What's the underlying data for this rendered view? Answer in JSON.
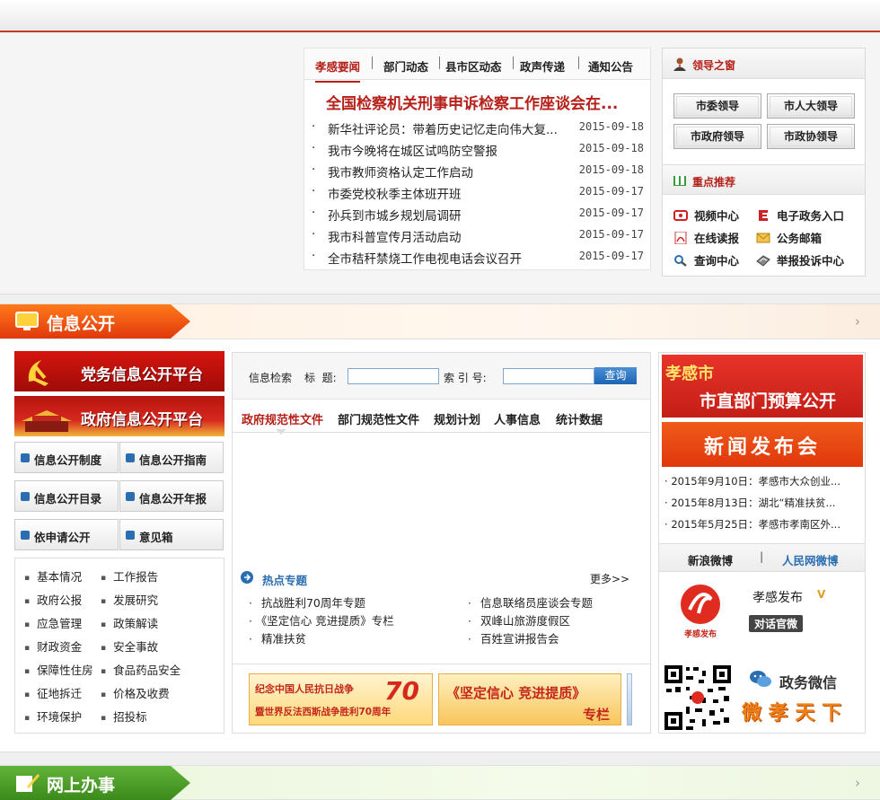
{
  "news": {
    "tabs": [
      "孝感要闻",
      "部门动态",
      "县市区动态",
      "政声传递",
      "通知公告"
    ],
    "headline": "全国检察机关刑事申诉检察工作座谈会在...",
    "items": [
      {
        "title": "新华社评论员：带着历史记忆走向伟大复...",
        "date": "2015-09-18"
      },
      {
        "title": "我市今晚将在城区试鸣防空警报",
        "date": "2015-09-18"
      },
      {
        "title": "我市教师资格认定工作启动",
        "date": "2015-09-18"
      },
      {
        "title": "市委党校秋季主体班开班",
        "date": "2015-09-17"
      },
      {
        "title": "孙兵到市城乡规划局调研",
        "date": "2015-09-17"
      },
      {
        "title": "我市科普宣传月活动启动",
        "date": "2015-09-17"
      },
      {
        "title": "全市秸秆禁烧工作电视电话会议召开",
        "date": "2015-09-17"
      }
    ]
  },
  "leader": {
    "title": "领导之窗",
    "buttons": [
      "市委领导",
      "市人大领导",
      "市政府领导",
      "市政协领导"
    ]
  },
  "featured": {
    "title": "重点推荐",
    "links": [
      "视频中心",
      "电子政务入口",
      "在线读报",
      "公务邮箱",
      "查询中心",
      "举报投诉中心"
    ]
  },
  "info_section": {
    "title": "信息公开",
    "banners": [
      "党务信息公开平台",
      "政府信息公开平台"
    ],
    "buttons": [
      "信息公开制度",
      "信息公开指南",
      "信息公开目录",
      "信息公开年报",
      "依申请公开",
      "意见箱"
    ],
    "categories": [
      "基本情况",
      "工作报告",
      "政府公报",
      "发展研究",
      "应急管理",
      "政策解读",
      "财政资金",
      "安全事故",
      "保障性住房",
      "食品药品安全",
      "征地拆迁",
      "价格及收费",
      "环境保护",
      "招投标"
    ]
  },
  "search": {
    "label": "信息检索",
    "title_label": "标  题:",
    "index_label": "索 引 号:",
    "button": "查询"
  },
  "doc_tabs": [
    "政府规范性文件",
    "部门规范性文件",
    "规划计划",
    "人事信息",
    "统计数据"
  ],
  "hot": {
    "title": "热点专题",
    "more": "更多>>",
    "items": [
      "抗战胜利70周年专题",
      "信息联络员座谈会专题",
      "《坚定信心 竞进提质》专栏",
      "双峰山旅游度假区",
      "精准扶贫",
      "百姓宣讲报告会"
    ]
  },
  "pics": {
    "pic1_top": "纪念中国人民抗日战争",
    "pic1_bottom": "暨世界反法西斯战争胜利70周年",
    "pic1_num": "70",
    "pic2_main": "《坚定信心 竞进提质》",
    "pic2_sub": "专栏"
  },
  "right": {
    "budget_city": "孝感市",
    "budget_text": "市直部门预算公开",
    "press": "新闻发布会",
    "news": [
      "2015年9月10日：孝感市大众创业...",
      "2015年8月13日：湖北“精准扶贫...",
      "2015年5月25日：孝感市孝南区外..."
    ],
    "weibo_tabs": [
      "新浪微博",
      "人民网微博"
    ],
    "weibo_name": "孝感发布",
    "weibo_badge": "对话官微",
    "logo_caption": "孝感发布",
    "wechat_label": "政务微信",
    "wechat_slogan": "微 孝 天 下"
  },
  "online_section": {
    "title": "网上办事"
  }
}
